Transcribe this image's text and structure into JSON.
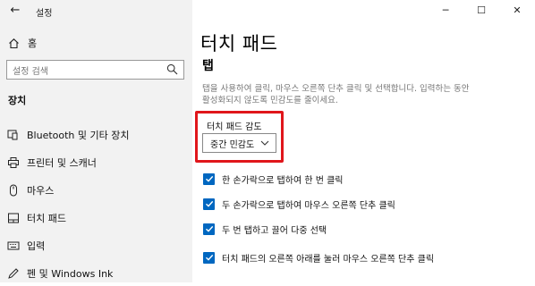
{
  "window": {
    "title": "설정",
    "controls": {
      "minimize": "─",
      "maximize": "☐",
      "close": "✕"
    }
  },
  "sidebar": {
    "home_label": "홈",
    "search_placeholder": "설정 검색",
    "section_label": "장치",
    "items": [
      {
        "label": "Bluetooth 및 기타 장치",
        "icon": "bluetooth-devices-icon"
      },
      {
        "label": "프린터 및 스캐너",
        "icon": "printer-icon"
      },
      {
        "label": "마우스",
        "icon": "mouse-icon"
      },
      {
        "label": "터치 패드",
        "icon": "touchpad-icon",
        "selected": true
      },
      {
        "label": "입력",
        "icon": "keyboard-icon"
      },
      {
        "label": "펜 및 Windows Ink",
        "icon": "pen-icon"
      }
    ]
  },
  "main": {
    "page_title": "터치 패드",
    "section_title": "탭",
    "description": "탭을 사용하여 클릭, 마우스 오른쪽 단추 클릭 및 선택합니다. 입력하는 동안 활성화되지 않도록 민감도를 줄이세요.",
    "sensitivity_label": "터치 패드 감도",
    "sensitivity_value": "중간 민감도",
    "checkboxes": [
      {
        "label": "한 손가락으로 탭하여 한 번 클릭",
        "checked": true
      },
      {
        "label": "두 손가락으로 탭하여 마우스 오른쪽 단추 클릭",
        "checked": true
      },
      {
        "label": "두 번 탭하고 끌어 다중 선택",
        "checked": true
      },
      {
        "label": "터치 패드의 오른쪽 아래를 눌러 마우스 오른쪽 단추 클릭",
        "checked": true
      }
    ]
  },
  "colors": {
    "accent": "#0067c0",
    "highlight": "#e0161b",
    "sidebar_bg": "#f2f2f2"
  }
}
